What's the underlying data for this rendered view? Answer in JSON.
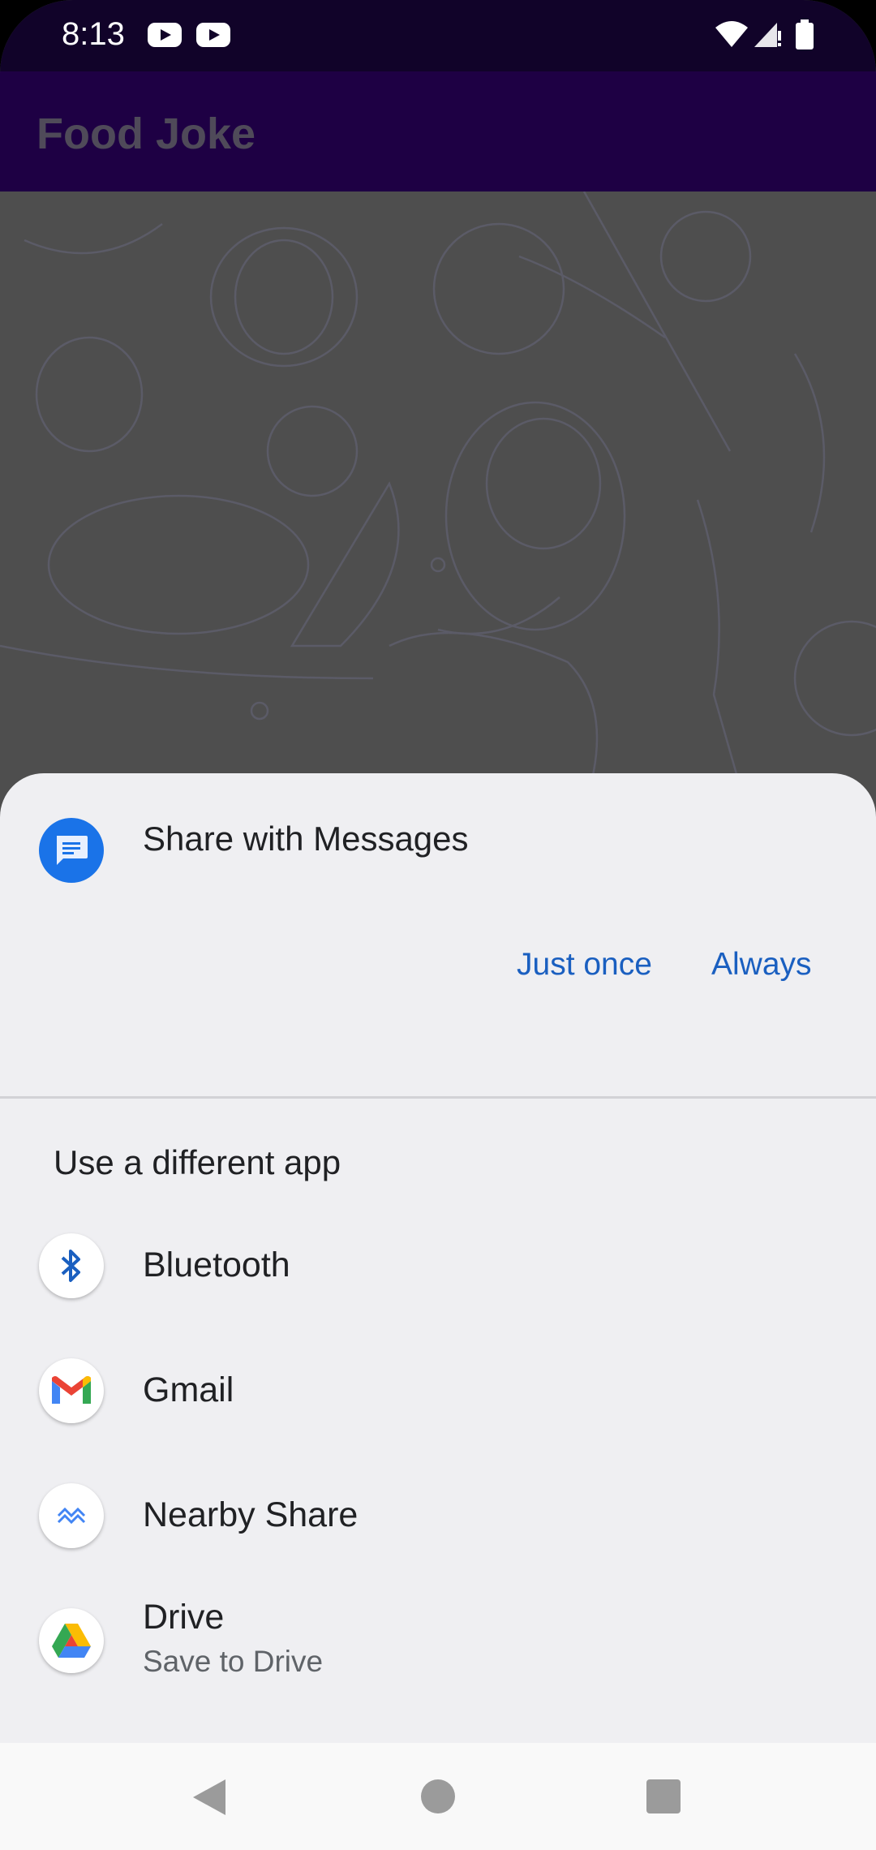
{
  "status_bar": {
    "time": "8:13"
  },
  "app_bar": {
    "title": "Food Joke"
  },
  "share_sheet": {
    "title": "Share with Messages",
    "just_once_label": "Just once",
    "always_label": "Always",
    "subheader": "Use a different app",
    "apps": [
      {
        "name": "Bluetooth"
      },
      {
        "name": "Gmail"
      },
      {
        "name": "Nearby Share"
      },
      {
        "name": "Drive",
        "subtitle": "Save to Drive"
      }
    ]
  },
  "colors": {
    "status_bar": "#110329",
    "app_bar": "#1e0044",
    "scrim_background": "#4e4e4e",
    "sheet_background": "#efeff2",
    "accent_link": "#1a5fc0",
    "messages_icon": "#1a73e8"
  },
  "icons": [
    "youtube-icon",
    "wifi-icon",
    "signal-icon",
    "battery-icon",
    "messages-icon",
    "bluetooth-icon",
    "gmail-icon",
    "nearby-share-icon",
    "drive-icon"
  ]
}
